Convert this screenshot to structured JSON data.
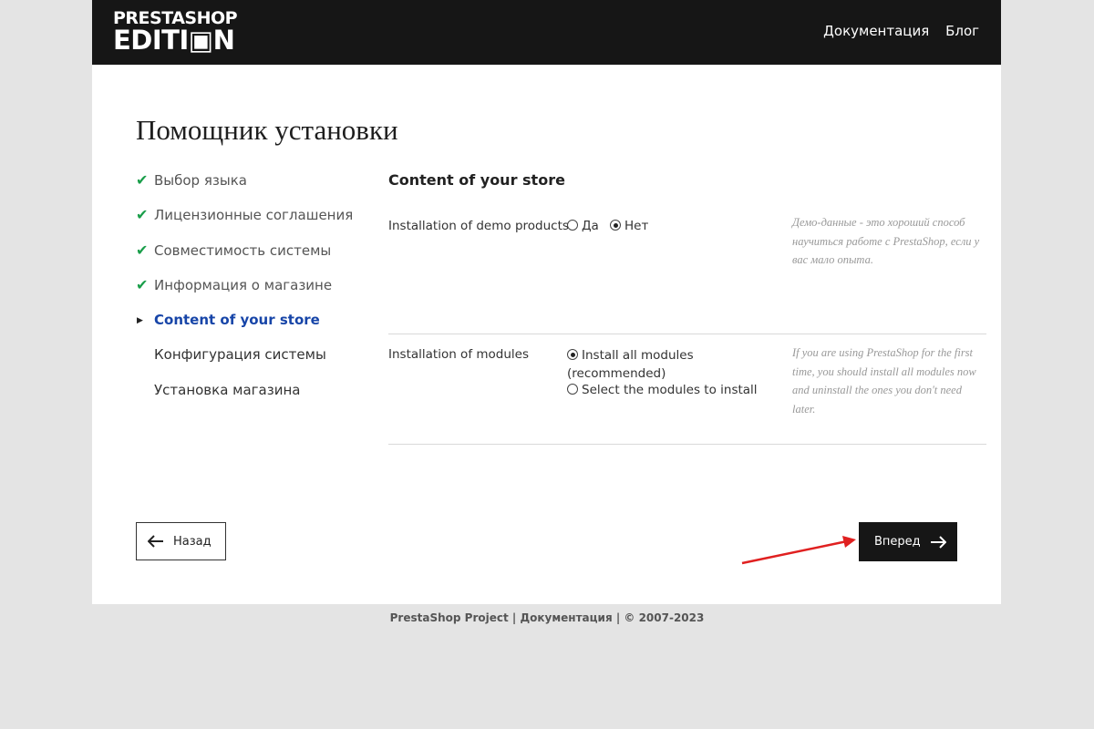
{
  "header": {
    "logo_line1": "PRESTASHOP",
    "logo_line2": "EDITI▣N",
    "nav": [
      "Документация",
      "Блог"
    ]
  },
  "page": {
    "title": "Помощник установки"
  },
  "steps": [
    {
      "label": "Выбор языка",
      "state": "done",
      "icon": "check-icon"
    },
    {
      "label": "Лицензионные соглашения",
      "state": "done",
      "icon": "check-icon"
    },
    {
      "label": "Совместимость системы",
      "state": "done",
      "icon": "check-icon"
    },
    {
      "label": "Информация о магазине",
      "state": "done",
      "icon": "check-icon"
    },
    {
      "label": "Content of your store",
      "state": "current",
      "icon": "caret-right-icon"
    },
    {
      "label": "Конфигурация системы",
      "state": "pending"
    },
    {
      "label": "Установка магазина",
      "state": "pending"
    }
  ],
  "content": {
    "section_title": "Content of your store",
    "demo": {
      "label": "Installation of demo products",
      "options": [
        {
          "label": "Да",
          "selected": false
        },
        {
          "label": "Нет",
          "selected": true
        }
      ],
      "help": "Демо-данные - это хороший способ научиться работе с PrestaShop, если у вас мало опыта."
    },
    "modules": {
      "label": "Installation of modules",
      "options": [
        {
          "label": "Install all modules (recommended)",
          "selected": true
        },
        {
          "label": "Select the modules to install",
          "selected": false
        }
      ],
      "help": "If you are using PrestaShop for the first time, you should install all modules now and uninstall the ones you don't need later."
    }
  },
  "buttons": {
    "back": "Назад",
    "next": "Вперед"
  },
  "colors": {
    "header_bg": "#161616",
    "check": "#1a9e4a",
    "active_step": "#1745a8",
    "annotation_arrow": "#e02020"
  },
  "footer": {
    "text": "PrestaShop Project | Документация | © 2007-2023"
  }
}
